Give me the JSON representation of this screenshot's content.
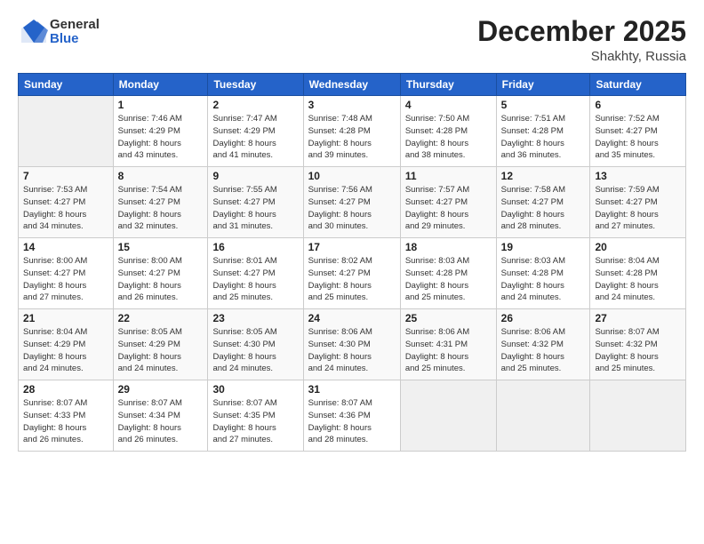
{
  "logo": {
    "general": "General",
    "blue": "Blue"
  },
  "title": "December 2025",
  "location": "Shakhty, Russia",
  "days_header": [
    "Sunday",
    "Monday",
    "Tuesday",
    "Wednesday",
    "Thursday",
    "Friday",
    "Saturday"
  ],
  "weeks": [
    [
      {
        "num": "",
        "info": ""
      },
      {
        "num": "1",
        "info": "Sunrise: 7:46 AM\nSunset: 4:29 PM\nDaylight: 8 hours\nand 43 minutes."
      },
      {
        "num": "2",
        "info": "Sunrise: 7:47 AM\nSunset: 4:29 PM\nDaylight: 8 hours\nand 41 minutes."
      },
      {
        "num": "3",
        "info": "Sunrise: 7:48 AM\nSunset: 4:28 PM\nDaylight: 8 hours\nand 39 minutes."
      },
      {
        "num": "4",
        "info": "Sunrise: 7:50 AM\nSunset: 4:28 PM\nDaylight: 8 hours\nand 38 minutes."
      },
      {
        "num": "5",
        "info": "Sunrise: 7:51 AM\nSunset: 4:28 PM\nDaylight: 8 hours\nand 36 minutes."
      },
      {
        "num": "6",
        "info": "Sunrise: 7:52 AM\nSunset: 4:27 PM\nDaylight: 8 hours\nand 35 minutes."
      }
    ],
    [
      {
        "num": "7",
        "info": "Sunrise: 7:53 AM\nSunset: 4:27 PM\nDaylight: 8 hours\nand 34 minutes."
      },
      {
        "num": "8",
        "info": "Sunrise: 7:54 AM\nSunset: 4:27 PM\nDaylight: 8 hours\nand 32 minutes."
      },
      {
        "num": "9",
        "info": "Sunrise: 7:55 AM\nSunset: 4:27 PM\nDaylight: 8 hours\nand 31 minutes."
      },
      {
        "num": "10",
        "info": "Sunrise: 7:56 AM\nSunset: 4:27 PM\nDaylight: 8 hours\nand 30 minutes."
      },
      {
        "num": "11",
        "info": "Sunrise: 7:57 AM\nSunset: 4:27 PM\nDaylight: 8 hours\nand 29 minutes."
      },
      {
        "num": "12",
        "info": "Sunrise: 7:58 AM\nSunset: 4:27 PM\nDaylight: 8 hours\nand 28 minutes."
      },
      {
        "num": "13",
        "info": "Sunrise: 7:59 AM\nSunset: 4:27 PM\nDaylight: 8 hours\nand 27 minutes."
      }
    ],
    [
      {
        "num": "14",
        "info": "Sunrise: 8:00 AM\nSunset: 4:27 PM\nDaylight: 8 hours\nand 27 minutes."
      },
      {
        "num": "15",
        "info": "Sunrise: 8:00 AM\nSunset: 4:27 PM\nDaylight: 8 hours\nand 26 minutes."
      },
      {
        "num": "16",
        "info": "Sunrise: 8:01 AM\nSunset: 4:27 PM\nDaylight: 8 hours\nand 25 minutes."
      },
      {
        "num": "17",
        "info": "Sunrise: 8:02 AM\nSunset: 4:27 PM\nDaylight: 8 hours\nand 25 minutes."
      },
      {
        "num": "18",
        "info": "Sunrise: 8:03 AM\nSunset: 4:28 PM\nDaylight: 8 hours\nand 25 minutes."
      },
      {
        "num": "19",
        "info": "Sunrise: 8:03 AM\nSunset: 4:28 PM\nDaylight: 8 hours\nand 24 minutes."
      },
      {
        "num": "20",
        "info": "Sunrise: 8:04 AM\nSunset: 4:28 PM\nDaylight: 8 hours\nand 24 minutes."
      }
    ],
    [
      {
        "num": "21",
        "info": "Sunrise: 8:04 AM\nSunset: 4:29 PM\nDaylight: 8 hours\nand 24 minutes."
      },
      {
        "num": "22",
        "info": "Sunrise: 8:05 AM\nSunset: 4:29 PM\nDaylight: 8 hours\nand 24 minutes."
      },
      {
        "num": "23",
        "info": "Sunrise: 8:05 AM\nSunset: 4:30 PM\nDaylight: 8 hours\nand 24 minutes."
      },
      {
        "num": "24",
        "info": "Sunrise: 8:06 AM\nSunset: 4:30 PM\nDaylight: 8 hours\nand 24 minutes."
      },
      {
        "num": "25",
        "info": "Sunrise: 8:06 AM\nSunset: 4:31 PM\nDaylight: 8 hours\nand 25 minutes."
      },
      {
        "num": "26",
        "info": "Sunrise: 8:06 AM\nSunset: 4:32 PM\nDaylight: 8 hours\nand 25 minutes."
      },
      {
        "num": "27",
        "info": "Sunrise: 8:07 AM\nSunset: 4:32 PM\nDaylight: 8 hours\nand 25 minutes."
      }
    ],
    [
      {
        "num": "28",
        "info": "Sunrise: 8:07 AM\nSunset: 4:33 PM\nDaylight: 8 hours\nand 26 minutes."
      },
      {
        "num": "29",
        "info": "Sunrise: 8:07 AM\nSunset: 4:34 PM\nDaylight: 8 hours\nand 26 minutes."
      },
      {
        "num": "30",
        "info": "Sunrise: 8:07 AM\nSunset: 4:35 PM\nDaylight: 8 hours\nand 27 minutes."
      },
      {
        "num": "31",
        "info": "Sunrise: 8:07 AM\nSunset: 4:36 PM\nDaylight: 8 hours\nand 28 minutes."
      },
      {
        "num": "",
        "info": ""
      },
      {
        "num": "",
        "info": ""
      },
      {
        "num": "",
        "info": ""
      }
    ]
  ]
}
